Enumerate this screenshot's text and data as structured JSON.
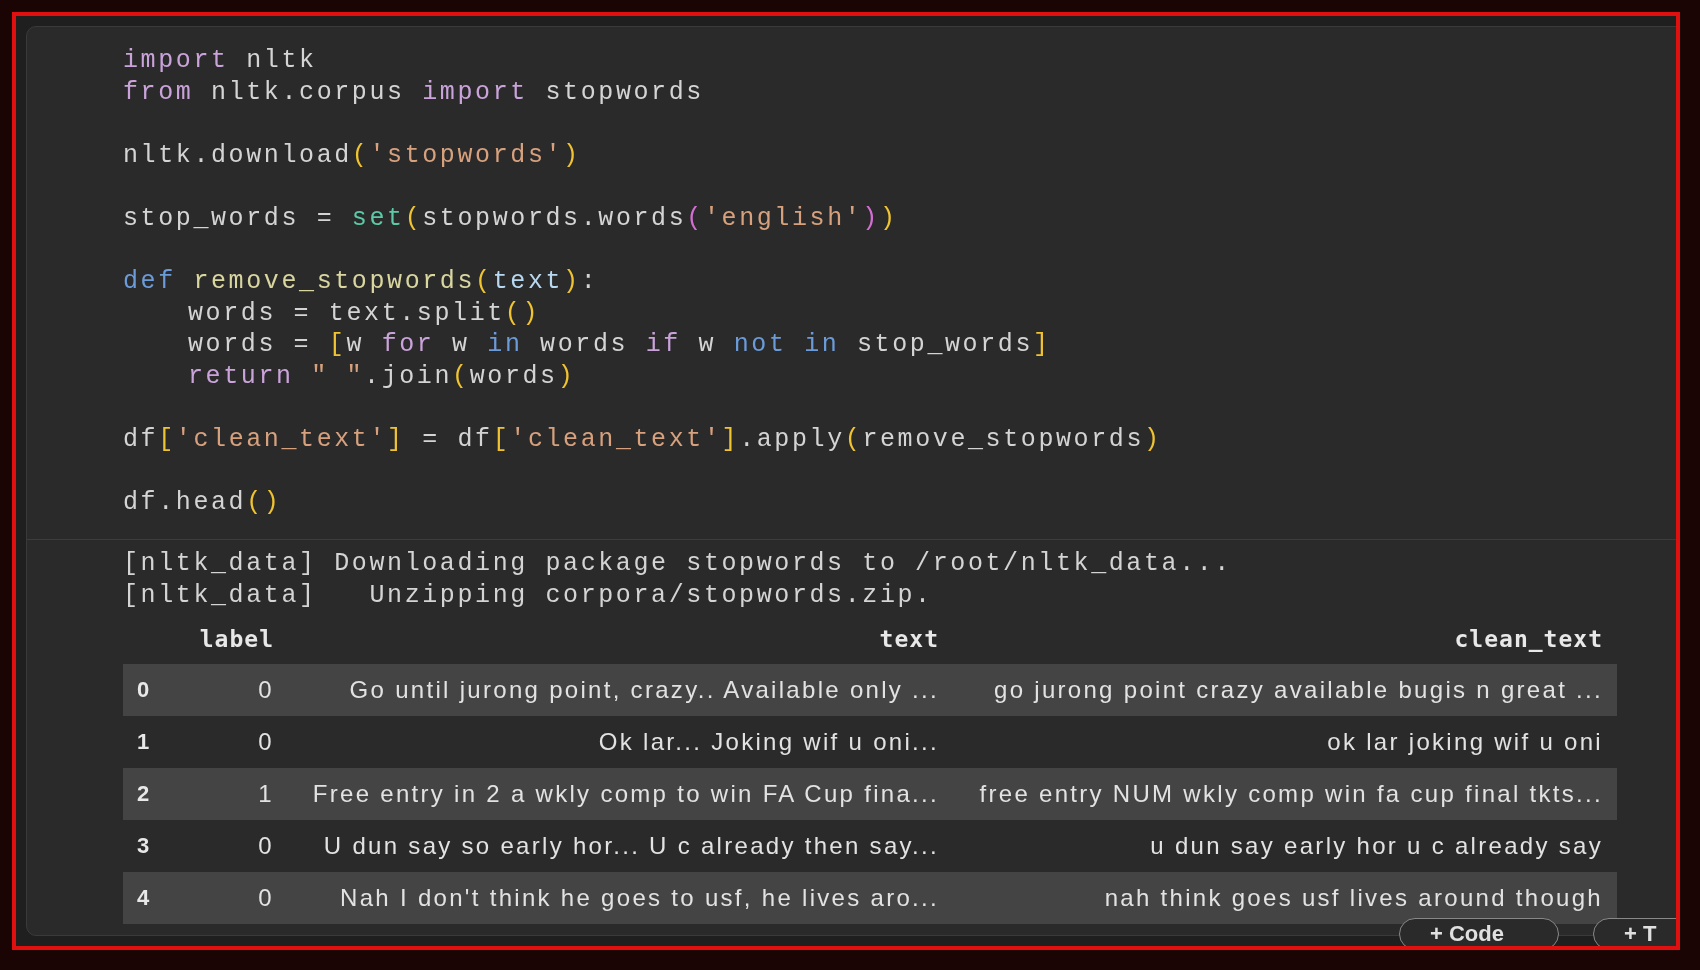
{
  "code_lines": [
    {
      "tokens": [
        {
          "t": "import",
          "kind": "kw"
        },
        {
          "t": " nltk",
          "kind": "plain"
        }
      ]
    },
    {
      "tokens": [
        {
          "t": "from",
          "kind": "kw"
        },
        {
          "t": " nltk.corpus ",
          "kind": "plain"
        },
        {
          "t": "import",
          "kind": "kw"
        },
        {
          "t": " stopwords",
          "kind": "plain"
        }
      ]
    },
    {
      "gap_before": true,
      "tokens": [
        {
          "t": "nltk.download",
          "kind": "plain"
        },
        {
          "t": "(",
          "kind": "br1"
        },
        {
          "t": "'stopwords'",
          "kind": "str"
        },
        {
          "t": ")",
          "kind": "br1"
        }
      ]
    },
    {
      "gap_before": true,
      "tokens": [
        {
          "t": "stop_words = ",
          "kind": "plain"
        },
        {
          "t": "set",
          "kind": "builtin"
        },
        {
          "t": "(",
          "kind": "br1"
        },
        {
          "t": "stopwords.words",
          "kind": "plain"
        },
        {
          "t": "(",
          "kind": "br2"
        },
        {
          "t": "'english'",
          "kind": "str"
        },
        {
          "t": ")",
          "kind": "br2"
        },
        {
          "t": ")",
          "kind": "br1"
        }
      ]
    },
    {
      "gap_before": true,
      "tokens": [
        {
          "t": "def",
          "kind": "def"
        },
        {
          "t": " remove_stopwords",
          "kind": "fn"
        },
        {
          "t": "(",
          "kind": "br1"
        },
        {
          "t": "text",
          "kind": "param"
        },
        {
          "t": ")",
          "kind": "br1"
        },
        {
          "t": ":",
          "kind": "plain"
        }
      ]
    },
    {
      "indented": true,
      "tokens": [
        {
          "t": "words = text.split",
          "kind": "plain"
        },
        {
          "t": "()",
          "kind": "br1"
        }
      ]
    },
    {
      "indented": true,
      "tokens": [
        {
          "t": "words = ",
          "kind": "plain"
        },
        {
          "t": "[",
          "kind": "br1"
        },
        {
          "t": "w ",
          "kind": "plain"
        },
        {
          "t": "for",
          "kind": "kw"
        },
        {
          "t": " w ",
          "kind": "plain"
        },
        {
          "t": "in",
          "kind": "def"
        },
        {
          "t": " words ",
          "kind": "plain"
        },
        {
          "t": "if",
          "kind": "kw"
        },
        {
          "t": " w ",
          "kind": "plain"
        },
        {
          "t": "not in",
          "kind": "def"
        },
        {
          "t": " stop_words",
          "kind": "plain"
        },
        {
          "t": "]",
          "kind": "br1"
        }
      ]
    },
    {
      "indented": true,
      "tokens": [
        {
          "t": "return",
          "kind": "kw"
        },
        {
          "t": " \" \"",
          "kind": "str"
        },
        {
          "t": ".join",
          "kind": "plain"
        },
        {
          "t": "(",
          "kind": "br1"
        },
        {
          "t": "words",
          "kind": "plain"
        },
        {
          "t": ")",
          "kind": "br1"
        }
      ]
    },
    {
      "gap_before": true,
      "tokens": [
        {
          "t": "df",
          "kind": "plain"
        },
        {
          "t": "[",
          "kind": "br1"
        },
        {
          "t": "'clean_text'",
          "kind": "str"
        },
        {
          "t": "]",
          "kind": "br1"
        },
        {
          "t": " = df",
          "kind": "plain"
        },
        {
          "t": "[",
          "kind": "br1"
        },
        {
          "t": "'clean_text'",
          "kind": "str"
        },
        {
          "t": "]",
          "kind": "br1"
        },
        {
          "t": ".apply",
          "kind": "plain"
        },
        {
          "t": "(",
          "kind": "br1"
        },
        {
          "t": "remove_stopwords",
          "kind": "plain"
        },
        {
          "t": ")",
          "kind": "br1"
        }
      ]
    },
    {
      "gap_before": true,
      "tokens": [
        {
          "t": "df.head",
          "kind": "plain"
        },
        {
          "t": "()",
          "kind": "br1"
        }
      ]
    }
  ],
  "output_lines": [
    "[nltk_data] Downloading package stopwords to /root/nltk_data...",
    "[nltk_data]   Unzipping corpora/stopwords.zip."
  ],
  "table": {
    "columns": [
      "label",
      "text",
      "clean_text"
    ],
    "rows": [
      {
        "index": "0",
        "cells": [
          "0",
          "Go until jurong point, crazy.. Available only ...",
          "go jurong point crazy available bugis n great ..."
        ]
      },
      {
        "index": "1",
        "cells": [
          "0",
          "Ok lar... Joking wif u oni...",
          "ok lar joking wif u oni"
        ]
      },
      {
        "index": "2",
        "cells": [
          "1",
          "Free entry in 2 a wkly comp to win FA Cup fina...",
          "free entry NUM wkly comp win fa cup final tkts..."
        ]
      },
      {
        "index": "3",
        "cells": [
          "0",
          "U dun say so early hor... U c already then say...",
          "u dun say early hor u c already say"
        ]
      },
      {
        "index": "4",
        "cells": [
          "0",
          "Nah I don't think he goes to usf, he lives aro...",
          "nah think goes usf lives around though"
        ]
      }
    ]
  },
  "buttons": [
    "+ Code",
    "+ T"
  ]
}
